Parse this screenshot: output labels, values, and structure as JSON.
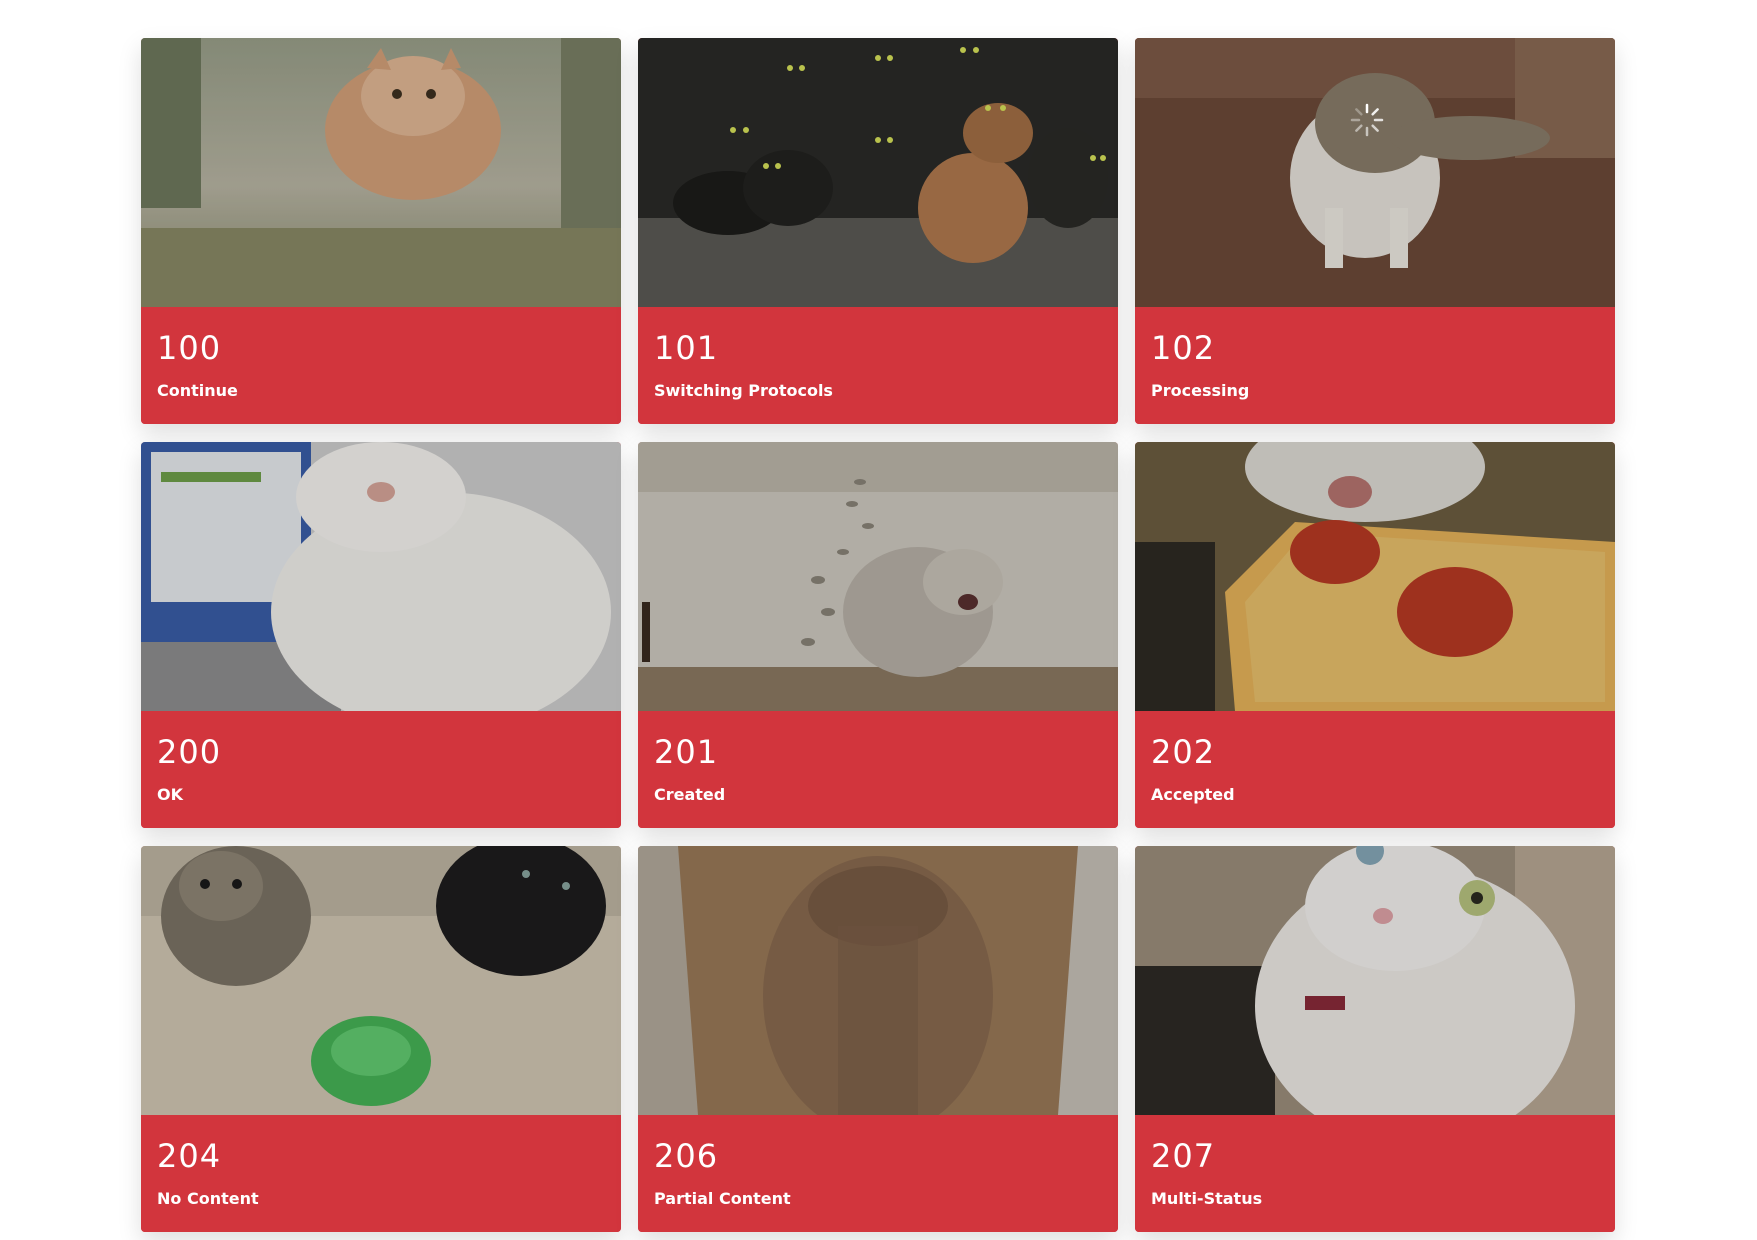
{
  "colors": {
    "caption_background": "#d2353d",
    "caption_text": "#ffffff",
    "page_background": "#ffffff"
  },
  "cards": [
    {
      "code": "100",
      "label": "Continue",
      "photo": "floating-cat-photo"
    },
    {
      "code": "101",
      "label": "Switching Protocols",
      "photo": "cats-glowing-eyes-photo"
    },
    {
      "code": "102",
      "label": "Processing",
      "photo": "cat-on-floor-photo",
      "overlay_icon": "loading-spinner-icon"
    },
    {
      "code": "200",
      "label": "OK",
      "photo": "white-cat-laptop-photo"
    },
    {
      "code": "201",
      "label": "Created",
      "photo": "cat-paw-prints-concrete-photo"
    },
    {
      "code": "202",
      "label": "Accepted",
      "photo": "cat-eating-pizza-photo"
    },
    {
      "code": "204",
      "label": "No Content",
      "photo": "two-cats-empty-bowl-photo"
    },
    {
      "code": "206",
      "label": "Partial Content",
      "photo": "cat-in-paper-bag-photo"
    },
    {
      "code": "207",
      "label": "Multi-Status",
      "photo": "white-cat-odd-eyes-photo"
    }
  ]
}
